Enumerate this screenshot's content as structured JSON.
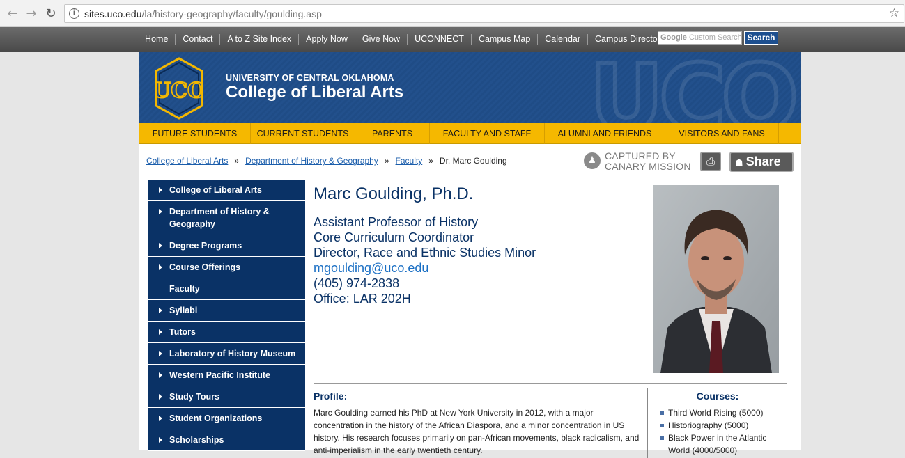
{
  "browser": {
    "url_host": "sites.uco.edu",
    "url_path": "/la/history-geography/faculty/goulding.asp"
  },
  "topnav": {
    "links": [
      "Home",
      "Contact",
      "A to Z Site Index",
      "Apply Now",
      "Give Now",
      "UCONNECT",
      "Campus Map",
      "Calendar",
      "Campus Directory"
    ],
    "search_placeholder": "Custom Search",
    "search_brand": "Google",
    "search_button": "Search"
  },
  "banner": {
    "university": "UNIVERSITY OF CENTRAL OKLAHOMA",
    "college": "College of Liberal Arts",
    "logo_text": "UCO"
  },
  "menubar": {
    "items": [
      "FUTURE STUDENTS",
      "CURRENT STUDENTS",
      "PARENTS",
      "FACULTY AND STAFF",
      "ALUMNI AND FRIENDS",
      "VISITORS AND FANS"
    ]
  },
  "breadcrumb": {
    "links": [
      "College of Liberal Arts",
      "Department of History & Geography",
      "Faculty"
    ],
    "separator": "»",
    "current": "Dr. Marc Goulding"
  },
  "tools": {
    "canary_line1": "CAPTURED BY",
    "canary_line2": "CANARY MISSION",
    "share_label": "Share"
  },
  "sidenav": {
    "items": [
      {
        "label": "College of Liberal Arts",
        "arrow": true
      },
      {
        "label": "Department of History & Geography",
        "arrow": true
      },
      {
        "label": "Degree Programs",
        "arrow": true
      },
      {
        "label": "Course Offerings",
        "arrow": true
      },
      {
        "label": "Faculty",
        "arrow": false
      },
      {
        "label": "Syllabi",
        "arrow": true
      },
      {
        "label": "Tutors",
        "arrow": true
      },
      {
        "label": "Laboratory of History Museum",
        "arrow": true
      },
      {
        "label": "Western Pacific Institute",
        "arrow": true
      },
      {
        "label": "Study Tours",
        "arrow": true
      },
      {
        "label": "Student Organizations",
        "arrow": true
      },
      {
        "label": "Scholarships",
        "arrow": true
      }
    ]
  },
  "faculty": {
    "name": "Marc Goulding, Ph.D.",
    "titles": [
      "Assistant Professor of History",
      "Core Curriculum Coordinator",
      "Director, Race and Ethnic Studies Minor"
    ],
    "email": "mgoulding@uco.edu",
    "phone": "(405) 974-2838",
    "office": "Office: LAR 202H"
  },
  "profile": {
    "heading": "Profile:",
    "text": "Marc Goulding earned his PhD at New York University in 2012, with a major concentration in the history of the African Diaspora, and a minor concentration in US history.  His research focuses primarily on pan-African movements, black radicalism, and anti-imperialism in the early twentieth century."
  },
  "courses": {
    "heading": "Courses:",
    "items": [
      "Third World Rising (5000)",
      "Historiography (5000)",
      "Black Power in the Atlantic World (4000/5000)"
    ]
  },
  "colors": {
    "navy": "#0a3266",
    "gold": "#f5b800",
    "banner_blue": "#1f4c86"
  }
}
